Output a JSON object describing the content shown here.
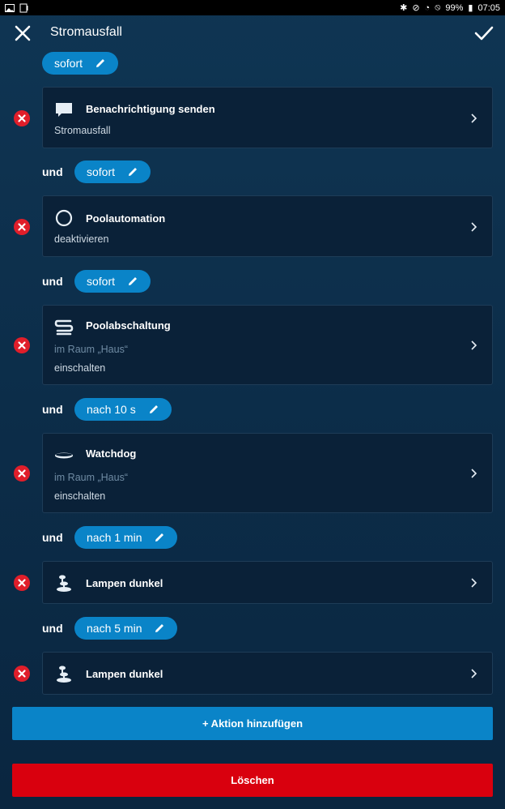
{
  "status_bar": {
    "battery": "99%",
    "time": "07:05"
  },
  "header": {
    "title": "Stromausfall"
  },
  "first_timing": {
    "label": "sofort"
  },
  "actions": [
    {
      "title": "Benachrichtigung senden",
      "subtitle": "Stromausfall",
      "icon": "chat-bubble-icon"
    },
    {
      "connector": "und",
      "timing": "sofort",
      "title": "Poolautomation",
      "subtitle": "deaktivieren",
      "icon": "circle-icon"
    },
    {
      "connector": "und",
      "timing": "sofort",
      "title": "Poolabschaltung",
      "room": "im Raum „Haus“",
      "subtitle": "einschalten",
      "icon": "smart-plug-icon"
    },
    {
      "connector": "und",
      "timing": "nach 10 s",
      "title": "Watchdog",
      "room": "im Raum „Haus“",
      "subtitle": "einschalten",
      "icon": "disc-device-icon"
    },
    {
      "connector": "und",
      "timing": "nach 1 min",
      "title": "Lampen dunkel",
      "icon": "lamp-scene-icon"
    },
    {
      "connector": "und",
      "timing": "nach 5 min",
      "title": "Lampen dunkel",
      "icon": "lamp-scene-icon"
    }
  ],
  "buttons": {
    "add_action": "+ Aktion hinzufügen",
    "delete": "Löschen"
  },
  "colors": {
    "accent": "#0a84c8",
    "danger": "#d9000e",
    "remove": "#e01e2a",
    "card_bg": "#0a2138"
  }
}
